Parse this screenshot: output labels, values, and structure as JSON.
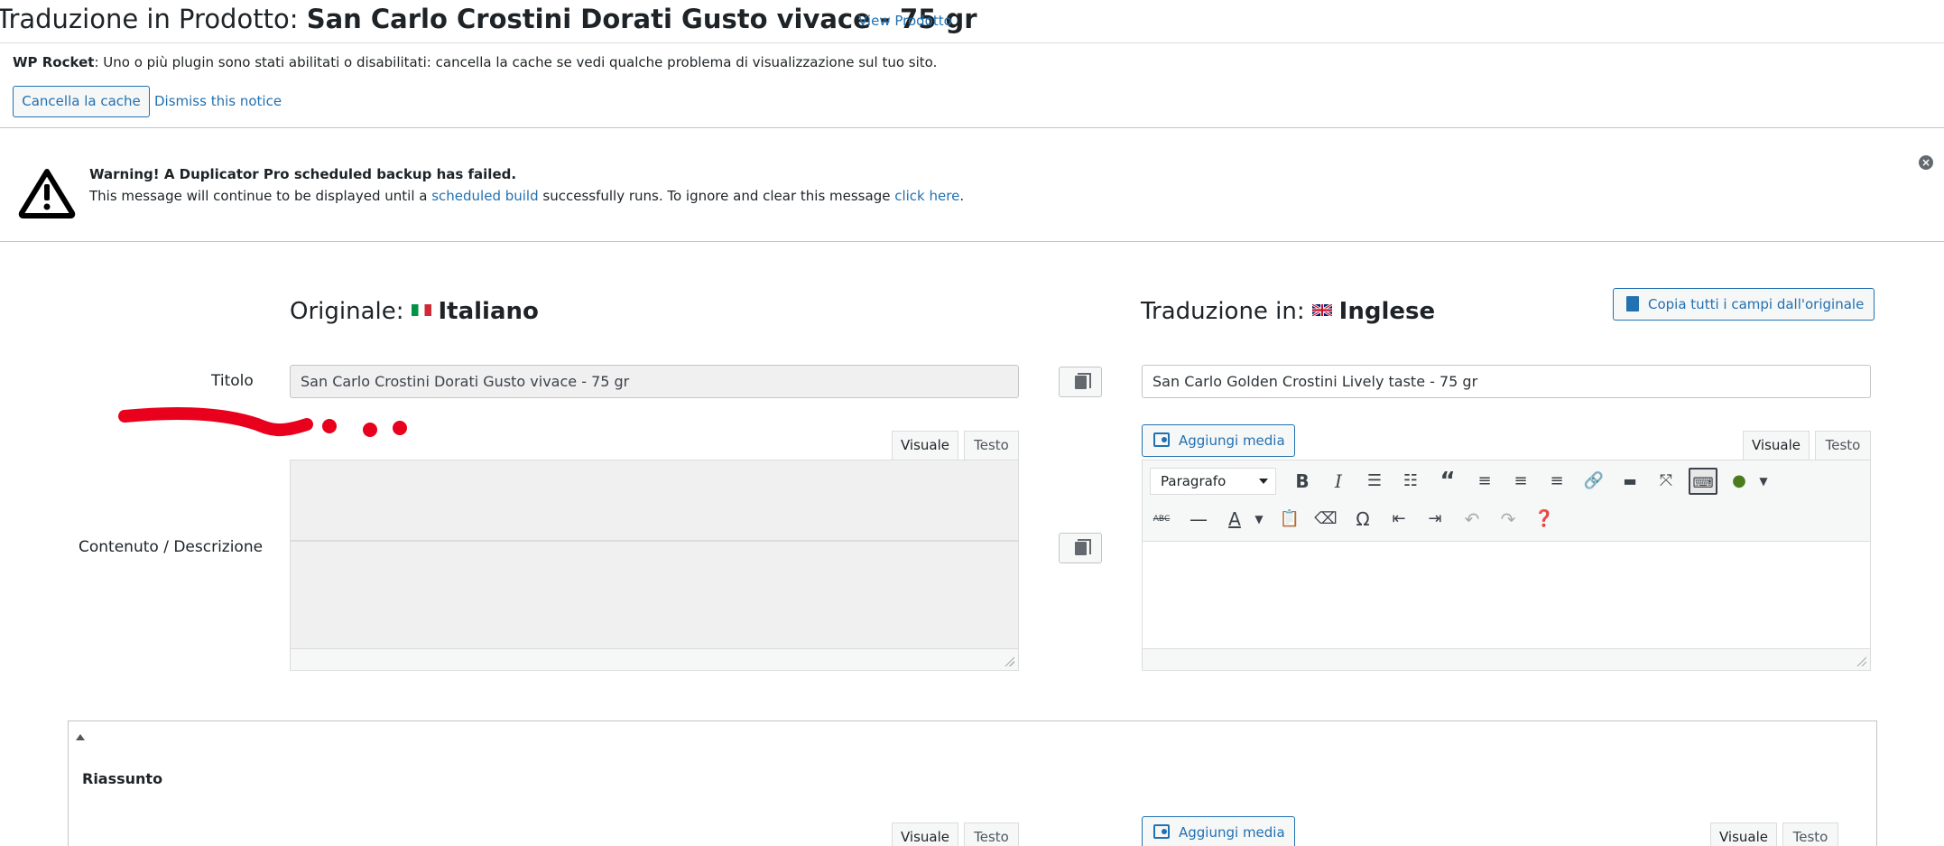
{
  "header": {
    "title_prefix": "Traduzione in Prodotto: ",
    "title_product": "San Carlo Crostini Dorati Gusto vivace - 75 gr",
    "view_link": "View Prodotto"
  },
  "rocket_notice": {
    "brand": "WP Rocket",
    "message": ": Uno o più plugin sono stati abilitati o disabilitati: cancella la cache se vedi qualche problema di visualizzazione sul tuo sito.",
    "clear_button": "Cancella la cache",
    "dismiss": "Dismiss this notice"
  },
  "duplicator_notice": {
    "title": "Warning! A Duplicator Pro scheduled backup has failed.",
    "text_before": "This message will continue to be displayed until a ",
    "link1": "scheduled build",
    "text_middle": " successfully runs. To ignore and clear this message ",
    "link2": "click here",
    "text_after": "."
  },
  "original": {
    "heading_prefix": "Originale:",
    "language": "Italiano",
    "title_value": "San Carlo Crostini Dorati Gusto vivace - 75 gr"
  },
  "translation": {
    "heading_prefix": "Traduzione in:",
    "language": "Inglese",
    "copy_all": "Copia tutti i campi dall'originale",
    "title_value": "San Carlo Golden Crostini Lively taste - 75 gr"
  },
  "labels": {
    "title": "Titolo",
    "content": "Contenuto / Descrizione"
  },
  "editor": {
    "tab_visual": "Visuale",
    "tab_text": "Testo",
    "add_media": "Aggiungi media",
    "format_select": "Paragrafo"
  },
  "summary": {
    "title": "Riassunto"
  },
  "colors": {
    "link": "#2271b1",
    "annotation": "#e8001c"
  }
}
